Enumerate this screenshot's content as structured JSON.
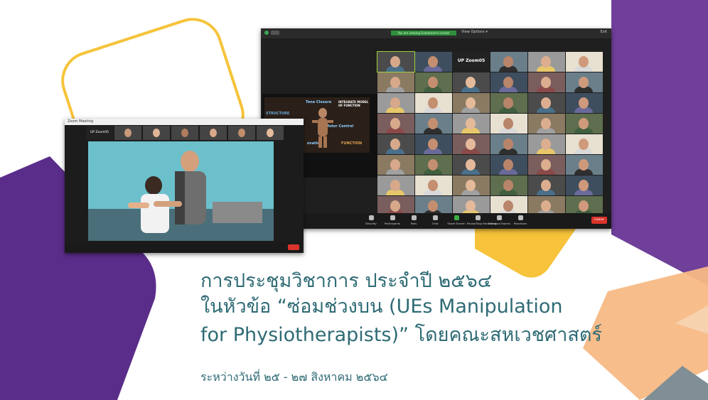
{
  "colors": {
    "purple": "#6f3f9a",
    "deep_purple": "#5b2d8a",
    "yellow": "#f6c33a",
    "peach": "#f7b985",
    "slate": "#7f8f95",
    "text_teal": "#2f6b75"
  },
  "headline": {
    "line1": "การประชุมวิชาการ ประจำปี ๒๕๖๔",
    "line2": "ในหัวข้อ “ซ่อมช่วงบน (UEs Manipulation",
    "line3": "for Physiotherapists)” โดยคณะสหเวชศาสตร์",
    "date": "ระหว่างวันที่ ๒๕ - ๒๗ สิงหาคม ๒๕๖๔"
  },
  "zoom_main": {
    "recording_banner": "You are viewing Grahamare's screen",
    "view_options": "View Options ▾",
    "exit_label": "Exit",
    "room_tile_title": "UP Zoom05",
    "shared_slide": {
      "structure": "STRUCTURE",
      "tone_closure": "Tone Closure",
      "integrate_model": "INTEGRATE MODEL OF FUNCTION",
      "motor_control": "Motor Control",
      "function": "FUNCTION",
      "ovation": "ovation"
    },
    "toolbar": [
      {
        "label": "Security",
        "icon": "shield-icon"
      },
      {
        "label": "Participants",
        "icon": "participants-icon"
      },
      {
        "label": "Polls",
        "icon": "polls-icon"
      },
      {
        "label": "Chat",
        "icon": "chat-icon"
      },
      {
        "label": "Share Screen",
        "icon": "share-screen-icon"
      },
      {
        "label": "Pause/Stop Recording",
        "icon": "record-icon"
      },
      {
        "label": "Breakout Rooms",
        "icon": "breakout-icon"
      },
      {
        "label": "Reactions",
        "icon": "reactions-icon"
      }
    ],
    "leave_label": "Leave"
  },
  "zoom_small": {
    "title": "Zoom Meeting",
    "room_label": "UP Zoom05"
  }
}
